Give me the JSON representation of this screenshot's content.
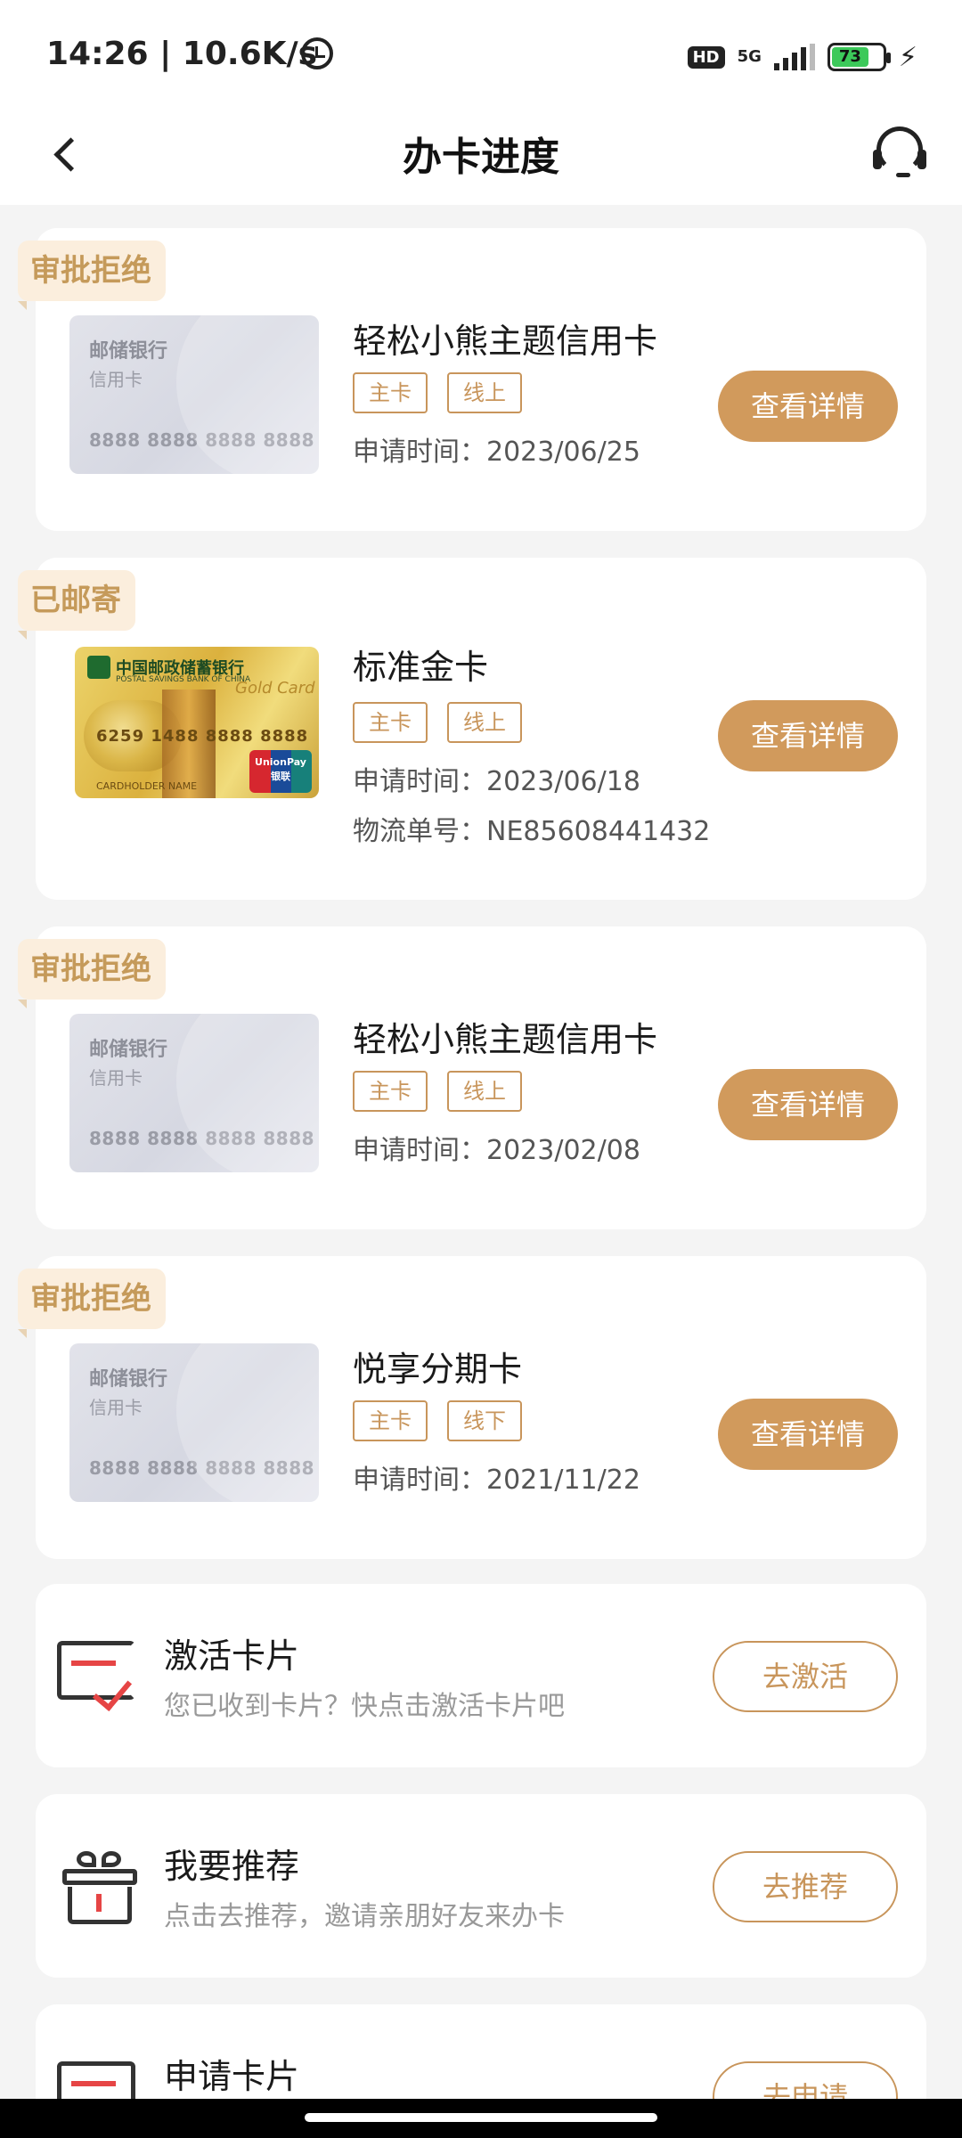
{
  "status_bar": {
    "time": "14:26 | 10.6K/s",
    "hd": "HD",
    "network": "5G",
    "battery": "73"
  },
  "header": {
    "title": "办卡进度"
  },
  "applications": [
    {
      "status": "审批拒绝",
      "card_style": "silver",
      "card_bank": "邮储银行",
      "card_type": "信用卡",
      "card_number": "8888 8888 8888 8888",
      "name": "轻松小熊主题信用卡",
      "tags": [
        "主卡",
        "线上"
      ],
      "apply_time": "申请时间：2023/06/25",
      "button": "查看详情"
    },
    {
      "status": "已邮寄",
      "card_style": "gold",
      "card_bank": "中国邮政储蓄银行",
      "card_bank_en": "POSTAL SAVINGS BANK OF CHINA",
      "card_number": "6259 1488 8888 8888",
      "card_holder": "CARDHOLDER NAME",
      "card_gold": "Gold Card",
      "card_network": "UnionPay 银联",
      "name": "标准金卡",
      "tags": [
        "主卡",
        "线上"
      ],
      "apply_time": "申请时间：2023/06/18",
      "tracking": "物流单号：NE85608441432",
      "button": "查看详情"
    },
    {
      "status": "审批拒绝",
      "card_style": "silver",
      "card_bank": "邮储银行",
      "card_type": "信用卡",
      "card_number": "8888 8888 8888 8888",
      "name": "轻松小熊主题信用卡",
      "tags": [
        "主卡",
        "线上"
      ],
      "apply_time": "申请时间：2023/02/08",
      "button": "查看详情"
    },
    {
      "status": "审批拒绝",
      "card_style": "silver",
      "card_bank": "邮储银行",
      "card_type": "信用卡",
      "card_number": "8888 8888 8888 8888",
      "name": "悦享分期卡",
      "tags": [
        "主卡",
        "线下"
      ],
      "apply_time": "申请时间：2021/11/22",
      "button": "查看详情"
    }
  ],
  "actions": [
    {
      "icon": "activate-card-icon",
      "title": "激活卡片",
      "desc": "您已收到卡片？快点击激活卡片吧",
      "button": "去激活"
    },
    {
      "icon": "gift-icon",
      "title": "我要推荐",
      "desc": "点击去推荐，邀请亲朋好友来办卡",
      "button": "去推荐"
    },
    {
      "icon": "apply-card-icon",
      "title": "申请卡片",
      "button": "去申请"
    }
  ],
  "colors": {
    "accent": "#d19a5c",
    "tag_border": "#c8955b",
    "status_tag_bg": "#fbeedd",
    "status_tag_text": "#c59a5a",
    "page_bg": "#f4f4f4"
  }
}
